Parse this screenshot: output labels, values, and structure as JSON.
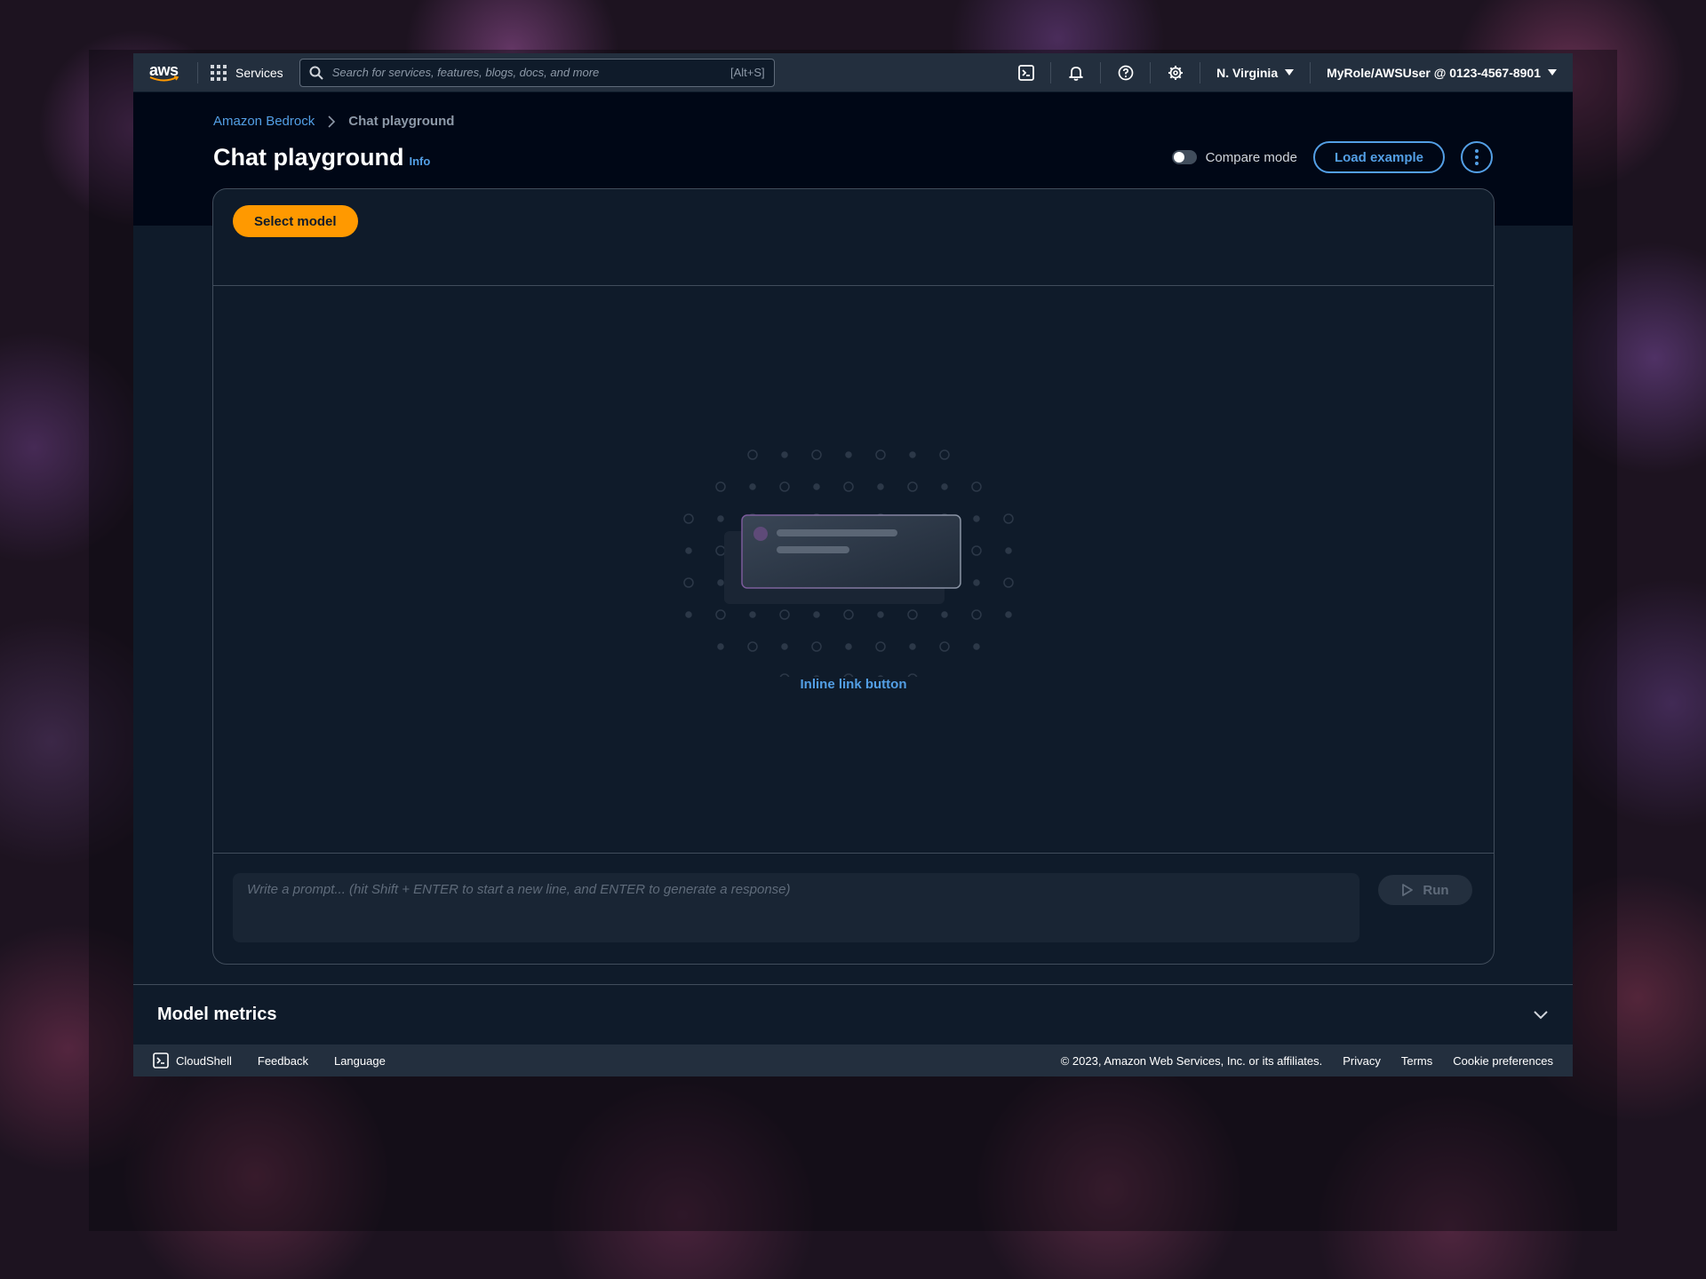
{
  "topnav": {
    "logo_text": "aws",
    "services_label": "Services",
    "search_placeholder": "Search for services, features, blogs, docs, and more",
    "search_shortcut": "[Alt+S]",
    "region": "N. Virginia",
    "account": "MyRole/AWSUser @ 0123-4567-8901",
    "icons": [
      "cloudshell-icon",
      "bell-icon",
      "help-icon",
      "settings-icon"
    ]
  },
  "breadcrumb": {
    "items": [
      "Amazon Bedrock",
      "Chat playground"
    ]
  },
  "header": {
    "title": "Chat playground",
    "info": "Info",
    "compare_mode": "Compare mode",
    "compare_mode_on": false,
    "load_example": "Load example"
  },
  "playground": {
    "select_model": "Select model",
    "empty_link": "Inline link button",
    "prompt_placeholder": "Write a prompt... (hit Shift + ENTER to start a new line, and ENTER to generate a response)",
    "run": "Run"
  },
  "metrics": {
    "title": "Model metrics"
  },
  "footer": {
    "cloudshell": "CloudShell",
    "feedback": "Feedback",
    "language": "Language",
    "copyright": "© 2023, Amazon Web Services, Inc. or its affiliates.",
    "privacy": "Privacy",
    "terms": "Terms",
    "cookies": "Cookie preferences"
  },
  "colors": {
    "accent_link": "#539fe5",
    "primary_button": "#ff9900",
    "nav_background": "#232f3e",
    "page_background": "#0f1b2a"
  }
}
